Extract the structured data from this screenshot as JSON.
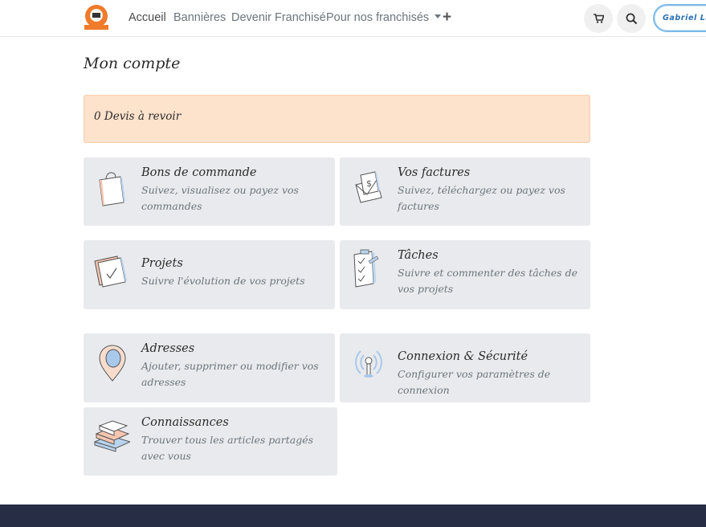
{
  "nav": {
    "items": [
      "Accueil",
      "Bannières",
      "Devenir Franchisé",
      "Pour nos franchisés"
    ],
    "user_label": "Gabriel La"
  },
  "page": {
    "title": "Mon compte",
    "alert": "0 Devis à revoir"
  },
  "cards": [
    {
      "title": "Bons de commande",
      "desc": "Suivez, visualisez ou payez vos commandes"
    },
    {
      "title": "Vos factures",
      "desc": "Suivez, téléchargez ou payez vos factures"
    },
    {
      "title": "Projets",
      "desc": "Suivre l'évolution de vos projets"
    },
    {
      "title": "Tâches",
      "desc": "Suivre et commenter des tâches de vos projets"
    },
    {
      "title": "Adresses",
      "desc": "Ajouter, supprimer ou modifier vos adresses"
    },
    {
      "title": "Connexion & Sécurité",
      "desc": "Configurer vos paramètres de connexion"
    },
    {
      "title": "Connaissances",
      "desc": "Trouver tous les articles partagés avec vous"
    }
  ],
  "colors": {
    "alert_bg": "#fde2cc",
    "card_bg": "#e9eaed",
    "footer_bg": "#262d44",
    "accent": "#7cb9ea"
  }
}
